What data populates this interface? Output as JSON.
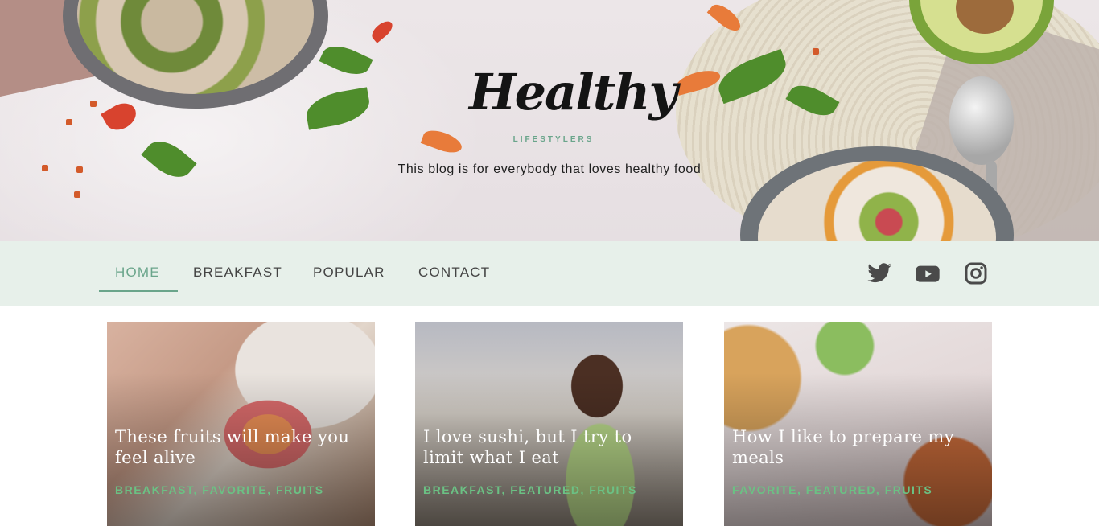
{
  "brand": {
    "logo_title": "Healthy",
    "logo_subtitle": "LIFESTYLERS",
    "tagline": "This blog is for everybody that loves healthy food"
  },
  "nav": {
    "items": [
      {
        "label": "HOME",
        "active": true
      },
      {
        "label": "BREAKFAST",
        "active": false
      },
      {
        "label": "POPULAR",
        "active": false
      },
      {
        "label": "CONTACT",
        "active": false
      }
    ],
    "social": [
      "twitter-icon",
      "youtube-icon",
      "instagram-icon"
    ]
  },
  "posts": [
    {
      "title": "These fruits will make you feel alive",
      "tags": "BREAKFAST, FAVORITE, FRUITS"
    },
    {
      "title": "I love sushi, but I try to limit what I eat",
      "tags": "BREAKFAST, FEATURED, FRUITS"
    },
    {
      "title": "How I like to prepare my meals",
      "tags": "FAVORITE, FEATURED, FRUITS"
    }
  ],
  "colors": {
    "accent": "#6aa58b",
    "nav_bg": "#e7f0ea",
    "tag_green": "#6bc184"
  }
}
